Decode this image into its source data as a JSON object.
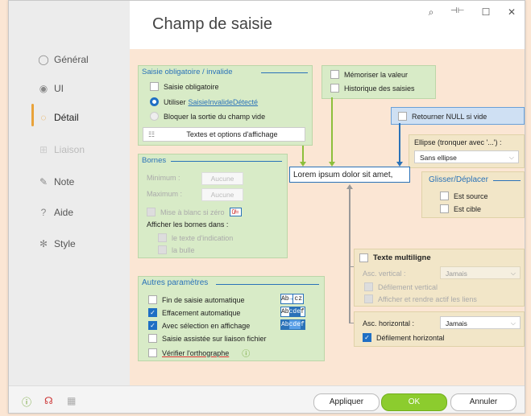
{
  "window": {
    "title": "Champ de saisie",
    "controls": {
      "search": "⌕",
      "pin": "⊣⊢",
      "maximize": "☐",
      "close": "✕"
    }
  },
  "sidebar": {
    "items": [
      {
        "label": "Général",
        "icon": "radio-circle-icon",
        "glyph": "◯",
        "state": "normal"
      },
      {
        "label": "UI",
        "icon": "eye-icon",
        "glyph": "◉",
        "state": "normal"
      },
      {
        "label": "Détail",
        "icon": "detail-icon",
        "glyph": "◌",
        "state": "active"
      },
      {
        "label": "Liaison",
        "icon": "link-icon",
        "glyph": "⊞",
        "state": "disabled"
      },
      {
        "label": "Note",
        "icon": "pencil-icon",
        "glyph": "✎",
        "state": "normal"
      },
      {
        "label": "Aide",
        "icon": "help-icon",
        "glyph": "?",
        "state": "normal"
      },
      {
        "label": "Style",
        "icon": "style-icon",
        "glyph": "✻",
        "state": "normal"
      }
    ]
  },
  "saisie": {
    "heading": "Saisie obligatoire / invalide",
    "obligatoire": "Saisie obligatoire",
    "utiliser": "Utiliser",
    "utiliser_link": "SaisieInvalideDétecté",
    "bloquer": "Bloquer la sortie du champ vide",
    "textes_btn": "Textes et options d'affichage"
  },
  "memo": {
    "memoriser": "Mémoriser la valeur",
    "historique": "Historique des saisies"
  },
  "retourner": {
    "label": "Retourner NULL si vide"
  },
  "ellipse": {
    "label": "Ellipse (tronquer avec '...') :",
    "value": "Sans ellipse"
  },
  "glisser": {
    "heading": "Glisser/Déplacer",
    "source": "Est source",
    "cible": "Est cible"
  },
  "bornes": {
    "heading": "Bornes",
    "minimum": "Minimum :",
    "maximum": "Maximum :",
    "aucune": "Aucune",
    "mise_blanc": "Mise à blanc si zéro",
    "mise_icon": "0̸=",
    "afficher": "Afficher les bornes dans :",
    "texte_indication": "le texte d'indication",
    "bulle": "la bulle"
  },
  "preview": {
    "text": "Lorem ipsum dolor sit amet,"
  },
  "multiligne": {
    "label": "Texte multiligne",
    "asc_vertical": "Asc. vertical :",
    "asc_vertical_value": "Jamais",
    "defil_vertical": "Défilement vertical",
    "afficher_liens": "Afficher et rendre actif les liens"
  },
  "horizontal": {
    "asc_label": "Asc. horizontal :",
    "asc_value": "Jamais",
    "defil_horizontal": "Défilement horizontal"
  },
  "autres": {
    "heading": "Autres paramètres",
    "fin_saisie": "Fin de saisie automatique",
    "effacement": "Effacement automatique",
    "avec_selection": "Avec sélection en affichage",
    "assistee": "Saisie assistée sur liaison fichier",
    "verifier": "Vérifier l'orthographe",
    "sample1_a": "Ab",
    "sample1_b": "→",
    "sample1_c": "cz",
    "sample2_a": "Ab",
    "sample2_b": "cde",
    "sample2_c": "f",
    "sample3_a": "Ab",
    "sample3_b": "cde",
    "sample3_c": "f"
  },
  "footer": {
    "appliquer": "Appliquer",
    "ok": "OK",
    "annuler": "Annuler"
  },
  "colors": {
    "accent": "#2a72b8",
    "green_panel": "#d8ebc7",
    "tan_panel": "#f2e6c8",
    "ok_button": "#8ccc2e",
    "active_nav": "#e8a23a"
  }
}
